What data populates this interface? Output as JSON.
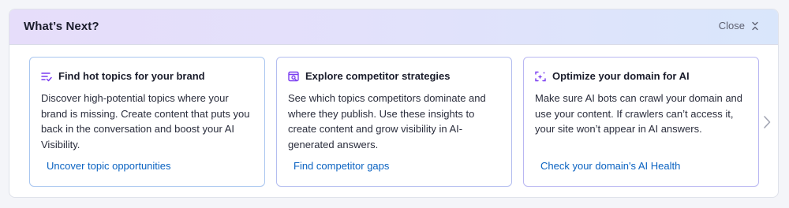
{
  "panel": {
    "title": "What’s Next?",
    "close_label": "Close"
  },
  "cards": [
    {
      "icon": "list-check-icon",
      "title": "Find hot topics for your brand",
      "description": "Discover high-potential topics where your brand is missing. Create content that puts you back in the conversation and boost your AI Visibility.",
      "link": "Uncover topic opportunities"
    },
    {
      "icon": "search-window-icon",
      "title": "Explore competitor strategies",
      "description": "See which topics competitors dominate and where they publish. Use these insights to create content and grow visibility in AI-generated answers.",
      "link": "Find competitor gaps"
    },
    {
      "icon": "ai-sparkle-frame-icon",
      "title": "Optimize your domain for AI",
      "description": "Make sure AI bots can crawl your domain and use your content. If crawlers can’t access it, your site won’t appear in AI answers.",
      "link": "Check your domain's AI Health"
    }
  ],
  "colors": {
    "accent_purple": "#7a3df0",
    "link_blue": "#0b63c2"
  }
}
